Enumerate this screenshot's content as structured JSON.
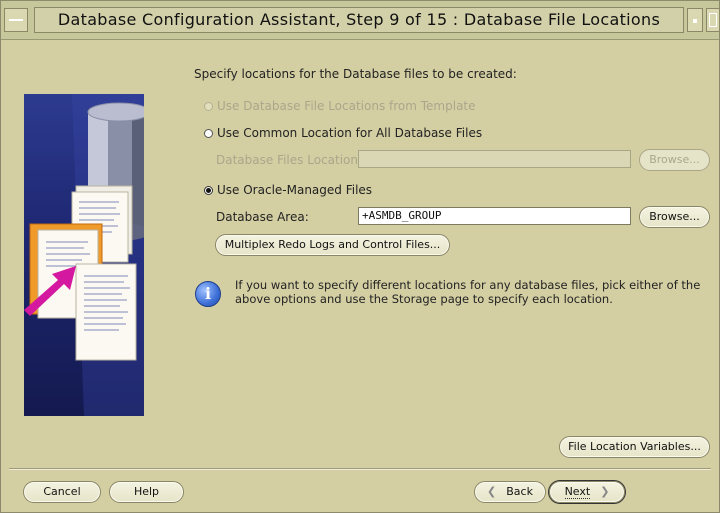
{
  "window": {
    "title": "Database Configuration Assistant, Step 9 of 15 : Database File Locations"
  },
  "content": {
    "heading": "Specify locations for the Database files to be created:",
    "option_template": "Use Database File Locations from Template",
    "option_common": "Use Common Location for All Database Files",
    "db_files_location_label": "Database Files Location:",
    "db_files_location_value": "",
    "browse_disabled_label": "Browse...",
    "option_omf": "Use Oracle-Managed Files",
    "db_area_label": "Database Area:",
    "db_area_value": "+ASMDB_GROUP",
    "browse_label": "Browse...",
    "multiplex_label": "Multiplex Redo Logs and Control Files...",
    "info_text_1": "If you want to specify different locations for any database files, pick either of the",
    "info_text_2": "above options and use the Storage page to specify each location.",
    "file_loc_vars_label": "File Location Variables...",
    "selected_option": "Use Oracle-Managed Files"
  },
  "footer": {
    "cancel_label": "Cancel",
    "help_label": "Help",
    "back_label": "Back",
    "next_label": "Next"
  },
  "colors": {
    "window_bg": "#d4cfa3",
    "titlebar_bg": "#c6c79a",
    "art_bg": "#1d2670",
    "accent_magenta": "#d4189f",
    "folder_orange": "#f09a2a"
  },
  "icons": {
    "info": "info-icon",
    "window_menu": "window-menu-icon",
    "minimize": "minimize-icon",
    "maximize": "maximize-icon",
    "back": "chevron-left-icon",
    "next": "chevron-right-icon"
  }
}
